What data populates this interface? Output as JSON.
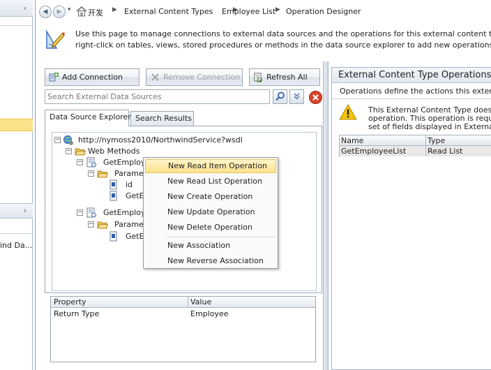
{
  "left_pane": {
    "item_text": "ind Da..."
  },
  "breadcrumb": {
    "items": [
      {
        "label": "开发"
      },
      {
        "label": "External Content Types"
      },
      {
        "label": "Employee List"
      },
      {
        "label": "Operation Designer"
      }
    ]
  },
  "info": {
    "line1": "Use this page to manage connections to external data sources and the operations for this external content type. A",
    "line2": "right-click on tables, views, stored procedures or methods in the data source explorer to add new operations."
  },
  "toolbar": {
    "add_connection": "Add Connection",
    "remove_connection": "Remove Connection",
    "refresh_all": "Refresh All"
  },
  "search": {
    "placeholder": "Search External Data Sources"
  },
  "tabs": [
    {
      "label": "Data Source Explorer",
      "active": true
    },
    {
      "label": "Search Results",
      "active": false
    }
  ],
  "tree": {
    "root": "http://nymoss2010/NorthwindService?wsdl",
    "web_methods": "Web Methods",
    "method1": "GetEmploye",
    "params1": "Paramet",
    "param_id": "id",
    "param_get1": "GetE",
    "method2": "GetEmploye",
    "params2": "Paramet",
    "param_get2": "GetE"
  },
  "context_menu": {
    "items": [
      {
        "label": "New Read Item Operation",
        "highlighted": true
      },
      {
        "label": "New Read List Operation"
      },
      {
        "label": "New Create Operation"
      },
      {
        "label": "New Update Operation"
      },
      {
        "label": "New Delete Operation"
      }
    ],
    "items2": [
      {
        "label": "New Association"
      },
      {
        "label": "New Reverse Association"
      }
    ]
  },
  "property_grid": {
    "headers": [
      "Property",
      "Value"
    ],
    "rows": [
      {
        "property": "Return Type",
        "value": "Employee"
      }
    ]
  },
  "ops_panel": {
    "title": "External Content Type Operations",
    "description": "Operations define the actions this externa",
    "warning_lines": [
      "This External Content Type does n",
      "operation. This operation is requi",
      "set of fields displayed in External"
    ],
    "grid": {
      "headers": [
        "Name",
        "Type"
      ],
      "rows": [
        {
          "name": "GetEmployeeList",
          "type": "Read List"
        }
      ]
    }
  },
  "colors": {
    "accent_highlight": "#fbe28a",
    "warning": "#f5c400",
    "delete_red": "#d9442a",
    "link_blue": "#2b5fae"
  },
  "icons": [
    "back-icon",
    "forward-icon",
    "home-icon",
    "info-edit-icon",
    "add-connection-icon",
    "remove-connection-icon",
    "refresh-icon",
    "search-icon",
    "chevron-down-icon",
    "delete-icon",
    "web-service-icon",
    "folder-icon",
    "method-icon",
    "parameter-icon",
    "warning-icon"
  ]
}
